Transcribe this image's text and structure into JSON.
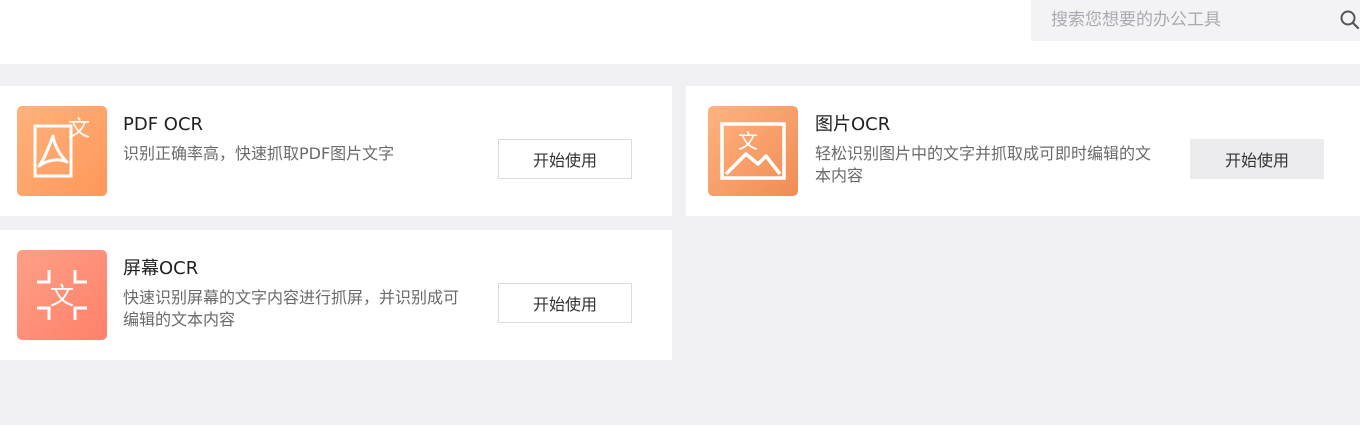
{
  "search": {
    "placeholder": "搜索您想要的办公工具",
    "icon": "search-icon"
  },
  "colors": {
    "pdf_tile_gradient": [
      "#ffb07a",
      "#ff9a5e"
    ],
    "image_tile_gradient": [
      "#ffb27d",
      "#f58f58"
    ],
    "screen_tile_gradient": [
      "#ff9b80",
      "#ff7f66"
    ]
  },
  "tools": [
    {
      "icon": "pdf-ocr-icon",
      "title": "PDF OCR",
      "description": "识别正确率高，快速抓取PDF图片文字",
      "button": "开始使用"
    },
    {
      "icon": "image-ocr-icon",
      "title": "图片OCR",
      "description": "轻松识别图片中的文字并抓取成可即时编辑的文本内容",
      "button": "开始使用"
    },
    {
      "icon": "screen-ocr-icon",
      "title": "屏幕OCR",
      "description": "快速识别屏幕的文字内容进行抓屏，并识别成可编辑的文本内容",
      "button": "开始使用"
    }
  ]
}
